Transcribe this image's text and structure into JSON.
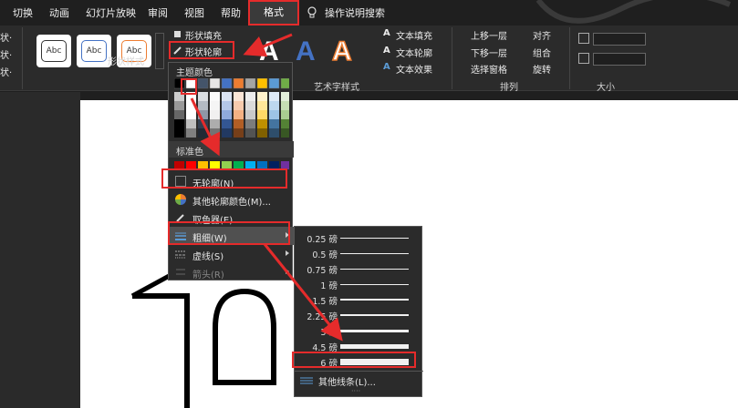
{
  "tabs": [
    "切换",
    "动画",
    "幻灯片放映",
    "审阅",
    "视图",
    "帮助"
  ],
  "active_tab": "格式",
  "tell_me": "操作说明搜索",
  "left_labels": [
    "状·",
    "状·",
    "状·"
  ],
  "shape_styles": {
    "swatch_text": "Abc",
    "group_label": "形状样式"
  },
  "shape_fill": "形状填充",
  "shape_outline": "形状轮廓",
  "wordart": {
    "glyph": "A",
    "group_label": "艺术字样式",
    "text_fill": "文本填充",
    "text_outline": "文本轮廓",
    "text_effects": "文本效果"
  },
  "arrange": {
    "bring_forward": "上移一层",
    "send_backward": "下移一层",
    "selection_pane": "选择窗格",
    "align": "对齐",
    "group": "组合",
    "rotate": "旋转",
    "group_label": "排列"
  },
  "size": {
    "group_label": "大小"
  },
  "menu": {
    "theme_colors_title": "主题颜色",
    "standard_colors_title": "标准色",
    "no_outline": "无轮廓(N)",
    "more_colors": "其他轮廓颜色(M)...",
    "eyedropper": "取色器(E)",
    "weight": "粗细(W)",
    "dashes": "虚线(S)",
    "arrows": "箭头(R)"
  },
  "theme_colors": [
    "#000000",
    "#ffffff",
    "#44546a",
    "#e7e6e6",
    "#4472c4",
    "#ed7d31",
    "#a5a5a5",
    "#ffc000",
    "#5b9bd5",
    "#70ad47"
  ],
  "standard_colors": [
    "#c00000",
    "#ff0000",
    "#ffc000",
    "#ffff00",
    "#92d050",
    "#00b050",
    "#00b0f0",
    "#0070c0",
    "#002060",
    "#7030a0"
  ],
  "weights": [
    {
      "label": "0.25 磅",
      "thickness": 0.25
    },
    {
      "label": "0.5 磅",
      "thickness": 0.5
    },
    {
      "label": "0.75 磅",
      "thickness": 0.75
    },
    {
      "label": "1 磅",
      "thickness": 1
    },
    {
      "label": "1.5 磅",
      "thickness": 1.5
    },
    {
      "label": "2.25 磅",
      "thickness": 2.25
    },
    {
      "label": "3 磅",
      "thickness": 3
    },
    {
      "label": "4.5 磅",
      "thickness": 4.5
    },
    {
      "label": "6 磅",
      "thickness": 6
    }
  ],
  "other_lines": "其他线条(L)...",
  "colors": {
    "highlight": "#e52b2b",
    "accent_blue": "#4472c4"
  }
}
